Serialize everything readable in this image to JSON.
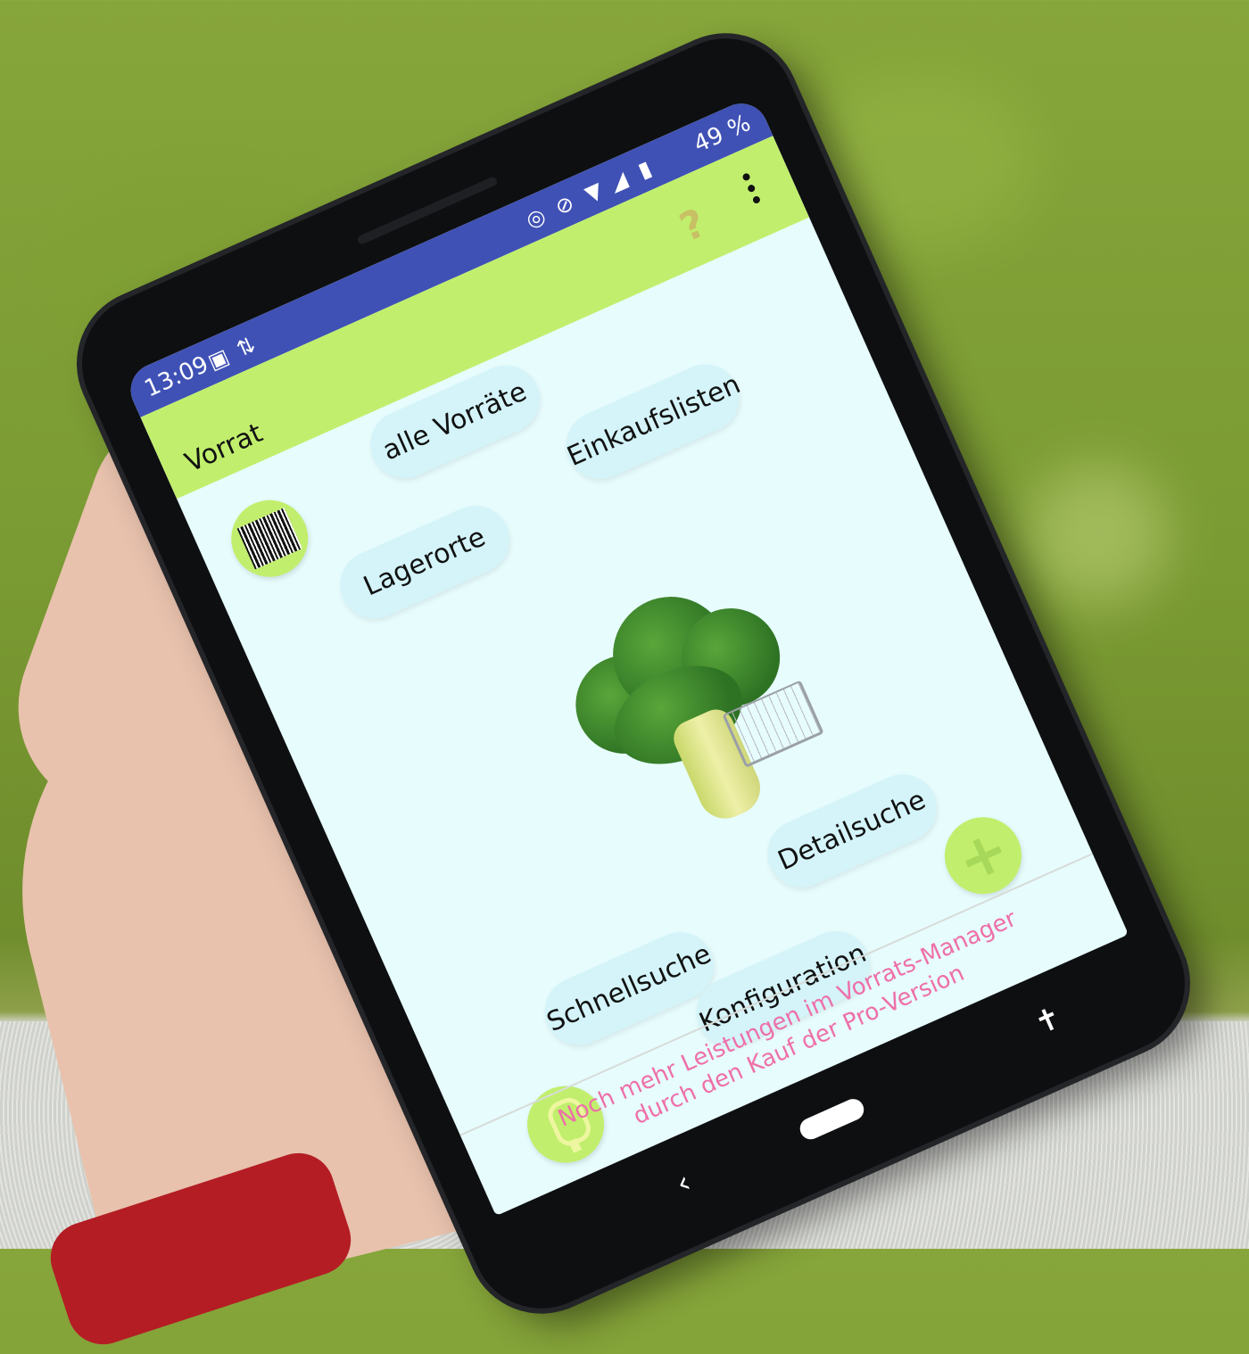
{
  "status_bar": {
    "time": "13:09",
    "battery": "49 %",
    "left_icons": [
      "image-icon",
      "sync-icon"
    ],
    "right_icons": [
      "data-saver-icon",
      "do-not-disturb-icon",
      "wifi-icon",
      "signal-icon",
      "battery-icon"
    ]
  },
  "app_bar": {
    "title": "Vorrat",
    "help_label": "?",
    "background_color": "#c1ef6d"
  },
  "main": {
    "buttons": {
      "alle_vorraete": "alle Vorräte",
      "einkaufslisten": "Einkaufslisten",
      "lagerorte": "Lagerorte",
      "detailsuche": "Detailsuche",
      "schnellsuche": "Schnellsuche",
      "konfiguration": "Konfiguration"
    },
    "plus_label": "+",
    "pill_color": "#d4f4f9",
    "accent_color": "#c1ef6d"
  },
  "promo": {
    "line1": "Noch mehr Leistungen im Vorrats-Manager",
    "line2": "durch den Kauf der Pro-Version",
    "color": "#ee6fa8"
  },
  "nav_bar": {
    "back_label": "‹",
    "accessibility_label": "🯅"
  }
}
